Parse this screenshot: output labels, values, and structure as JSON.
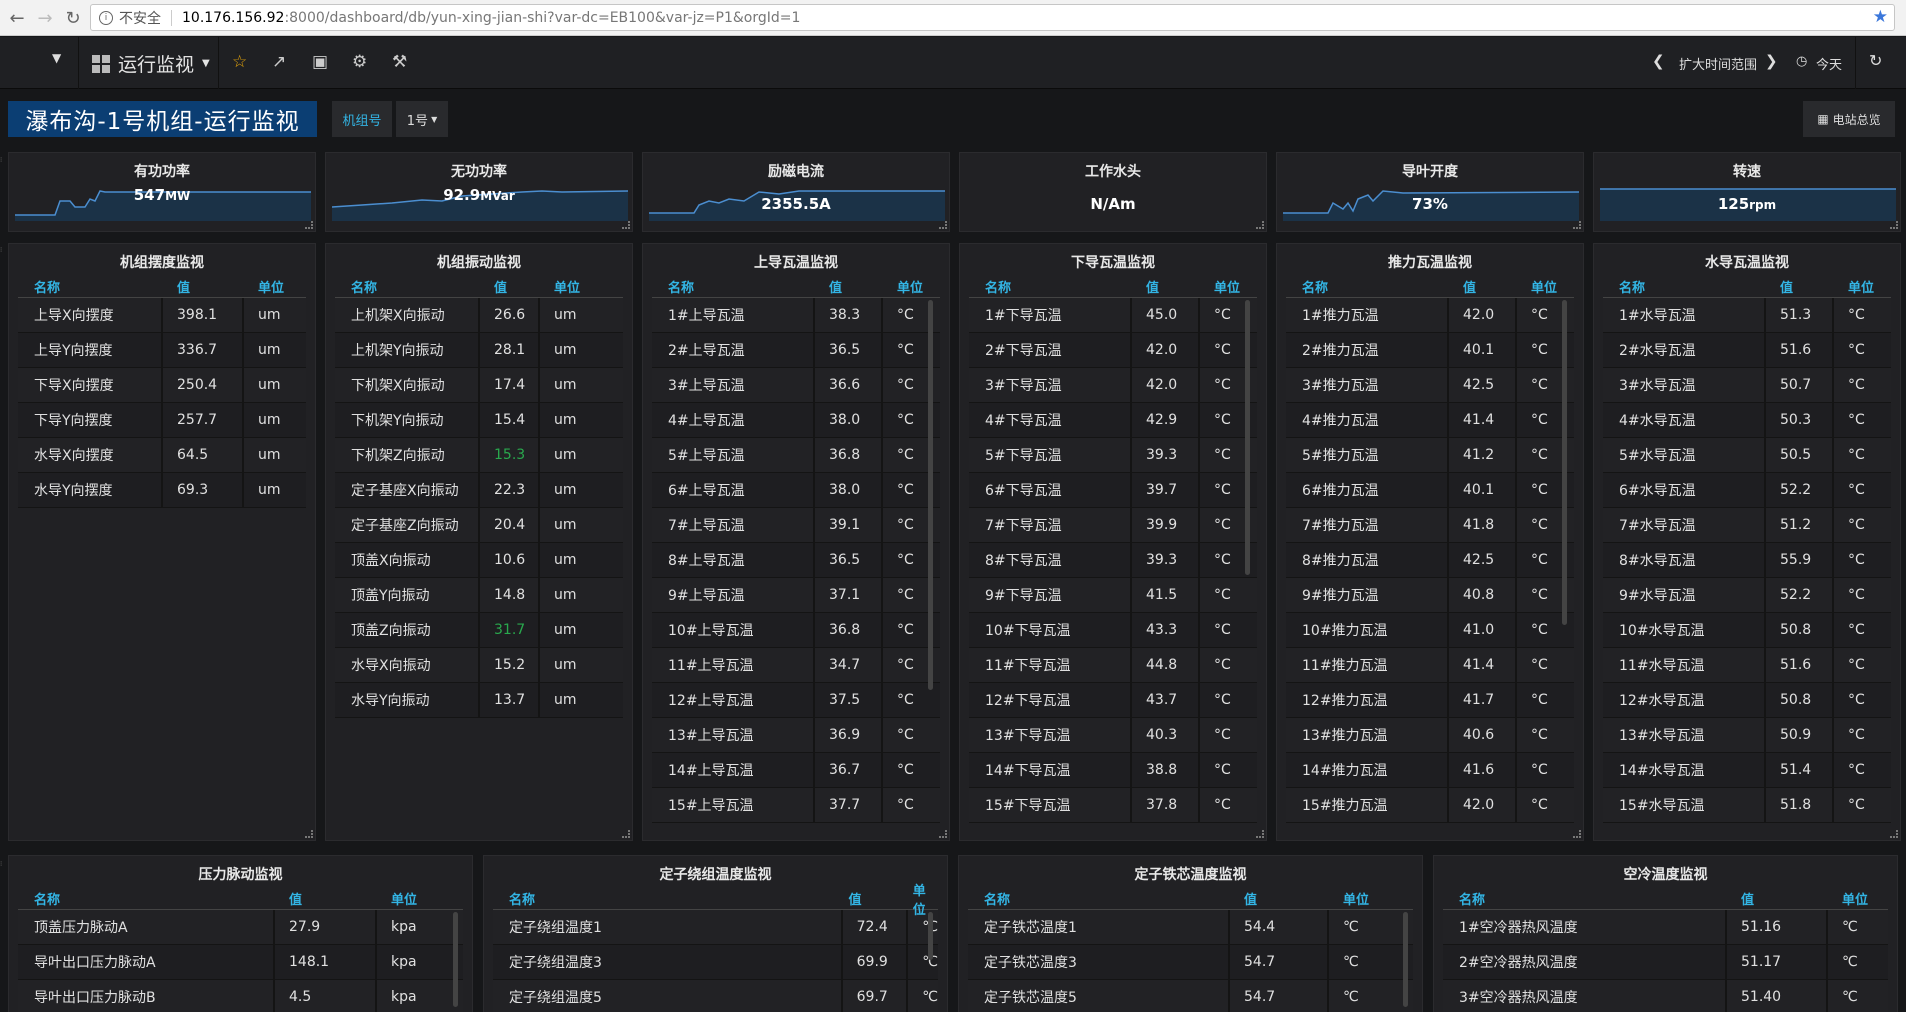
{
  "browser": {
    "insecure": "不安全",
    "host": "10.176.156.92",
    "path": ":8000/dashboard/db/yun-xing-jian-shi?var-dc=EB100&var-jz=P1&orgId=1"
  },
  "nav": {
    "dashboard_name": "运行监视",
    "time_range_label": "扩大时间范围",
    "time_today": "今天"
  },
  "header": {
    "title": "瀑布沟-1号机组-运行监视",
    "var_label": "机组号",
    "var_value": "1号",
    "station_button": "电站总览"
  },
  "stats": [
    {
      "title": "有功功率",
      "value": "547",
      "unit": "MW"
    },
    {
      "title": "无功功率",
      "value": "92.9",
      "unit": "MVar"
    },
    {
      "title": "励磁电流",
      "value": "2355.5A",
      "unit": ""
    },
    {
      "title": "工作水头",
      "value": "N/Am",
      "unit": ""
    },
    {
      "title": "导叶开度",
      "value": "73%",
      "unit": ""
    },
    {
      "title": "转速",
      "value": "125",
      "unit": "rpm"
    }
  ],
  "columns": {
    "name": "名称",
    "value": "值",
    "unit": "单位"
  },
  "panels": [
    {
      "title": "机组摆度监视",
      "rows": [
        [
          "上导X向摆度",
          "398.1",
          "um"
        ],
        [
          "上导Y向摆度",
          "336.7",
          "um"
        ],
        [
          "下导X向摆度",
          "250.4",
          "um"
        ],
        [
          "下导Y向摆度",
          "257.7",
          "um"
        ],
        [
          "水导X向摆度",
          "64.5",
          "um"
        ],
        [
          "水导Y向摆度",
          "69.3",
          "um"
        ]
      ]
    },
    {
      "title": "机组振动监视",
      "rows": [
        [
          "上机架X向振动",
          "26.6",
          "um"
        ],
        [
          "上机架Y向振动",
          "28.1",
          "um"
        ],
        [
          "下机架X向振动",
          "17.4",
          "um"
        ],
        [
          "下机架Y向振动",
          "15.4",
          "um"
        ],
        [
          "下机架Z向振动",
          "15.3",
          "um"
        ],
        [
          "定子基座X向振动",
          "22.3",
          "um"
        ],
        [
          "定子基座Z向振动",
          "20.4",
          "um"
        ],
        [
          "顶盖X向振动",
          "10.6",
          "um"
        ],
        [
          "顶盖Y向振动",
          "14.8",
          "um"
        ],
        [
          "顶盖Z向振动",
          "31.7",
          "um"
        ],
        [
          "水导X向振动",
          "15.2",
          "um"
        ],
        [
          "水导Y向振动",
          "13.7",
          "um"
        ]
      ]
    },
    {
      "title": "上导瓦温监视",
      "rows": [
        [
          "1#上导瓦温",
          "38.3",
          "°C"
        ],
        [
          "2#上导瓦温",
          "36.5",
          "°C"
        ],
        [
          "3#上导瓦温",
          "36.6",
          "°C"
        ],
        [
          "4#上导瓦温",
          "38.0",
          "°C"
        ],
        [
          "5#上导瓦温",
          "36.8",
          "°C"
        ],
        [
          "6#上导瓦温",
          "38.0",
          "°C"
        ],
        [
          "7#上导瓦温",
          "39.1",
          "°C"
        ],
        [
          "8#上导瓦温",
          "36.5",
          "°C"
        ],
        [
          "9#上导瓦温",
          "37.1",
          "°C"
        ],
        [
          "10#上导瓦温",
          "36.8",
          "°C"
        ],
        [
          "11#上导瓦温",
          "34.7",
          "°C"
        ],
        [
          "12#上导瓦温",
          "37.5",
          "°C"
        ],
        [
          "13#上导瓦温",
          "36.9",
          "°C"
        ],
        [
          "14#上导瓦温",
          "36.7",
          "°C"
        ],
        [
          "15#上导瓦温",
          "37.7",
          "°C"
        ]
      ]
    },
    {
      "title": "下导瓦温监视",
      "rows": [
        [
          "1#下导瓦温",
          "45.0",
          "°C"
        ],
        [
          "2#下导瓦温",
          "42.0",
          "°C"
        ],
        [
          "3#下导瓦温",
          "42.0",
          "°C"
        ],
        [
          "4#下导瓦温",
          "42.9",
          "°C"
        ],
        [
          "5#下导瓦温",
          "39.3",
          "°C"
        ],
        [
          "6#下导瓦温",
          "39.7",
          "°C"
        ],
        [
          "7#下导瓦温",
          "39.9",
          "°C"
        ],
        [
          "8#下导瓦温",
          "39.3",
          "°C"
        ],
        [
          "9#下导瓦温",
          "41.5",
          "°C"
        ],
        [
          "10#下导瓦温",
          "43.3",
          "°C"
        ],
        [
          "11#下导瓦温",
          "44.8",
          "°C"
        ],
        [
          "12#下导瓦温",
          "43.7",
          "°C"
        ],
        [
          "13#下导瓦温",
          "40.3",
          "°C"
        ],
        [
          "14#下导瓦温",
          "38.8",
          "°C"
        ],
        [
          "15#下导瓦温",
          "37.8",
          "°C"
        ]
      ]
    },
    {
      "title": "推力瓦温监视",
      "rows": [
        [
          "1#推力瓦温",
          "42.0",
          "°C"
        ],
        [
          "2#推力瓦温",
          "40.1",
          "°C"
        ],
        [
          "3#推力瓦温",
          "42.5",
          "°C"
        ],
        [
          "4#推力瓦温",
          "41.4",
          "°C"
        ],
        [
          "5#推力瓦温",
          "41.2",
          "°C"
        ],
        [
          "6#推力瓦温",
          "40.1",
          "°C"
        ],
        [
          "7#推力瓦温",
          "41.8",
          "°C"
        ],
        [
          "8#推力瓦温",
          "42.5",
          "°C"
        ],
        [
          "9#推力瓦温",
          "40.8",
          "°C"
        ],
        [
          "10#推力瓦温",
          "41.0",
          "°C"
        ],
        [
          "11#推力瓦温",
          "41.4",
          "°C"
        ],
        [
          "12#推力瓦温",
          "41.7",
          "°C"
        ],
        [
          "13#推力瓦温",
          "40.6",
          "°C"
        ],
        [
          "14#推力瓦温",
          "41.6",
          "°C"
        ],
        [
          "15#推力瓦温",
          "42.0",
          "°C"
        ]
      ]
    },
    {
      "title": "水导瓦温监视",
      "rows": [
        [
          "1#水导瓦温",
          "51.3",
          "°C"
        ],
        [
          "2#水导瓦温",
          "51.6",
          "°C"
        ],
        [
          "3#水导瓦温",
          "50.7",
          "°C"
        ],
        [
          "4#水导瓦温",
          "50.3",
          "°C"
        ],
        [
          "5#水导瓦温",
          "50.5",
          "°C"
        ],
        [
          "6#水导瓦温",
          "52.2",
          "°C"
        ],
        [
          "7#水导瓦温",
          "51.2",
          "°C"
        ],
        [
          "8#水导瓦温",
          "55.9",
          "°C"
        ],
        [
          "9#水导瓦温",
          "52.2",
          "°C"
        ],
        [
          "10#水导瓦温",
          "50.8",
          "°C"
        ],
        [
          "11#水导瓦温",
          "51.6",
          "°C"
        ],
        [
          "12#水导瓦温",
          "50.8",
          "°C"
        ],
        [
          "13#水导瓦温",
          "50.9",
          "°C"
        ],
        [
          "14#水导瓦温",
          "51.4",
          "°C"
        ],
        [
          "15#水导瓦温",
          "51.8",
          "°C"
        ]
      ]
    },
    {
      "title": "压力脉动监视",
      "rows": [
        [
          "顶盖压力脉动A",
          "27.9",
          "kpa"
        ],
        [
          "导叶出口压力脉动A",
          "148.1",
          "kpa"
        ],
        [
          "导叶出口压力脉动B",
          "4.5",
          "kpa"
        ]
      ]
    },
    {
      "title": "定子绕组温度监视",
      "rows": [
        [
          "定子绕组温度1",
          "72.4",
          "℃"
        ],
        [
          "定子绕组温度3",
          "69.9",
          "℃"
        ],
        [
          "定子绕组温度5",
          "69.7",
          "℃"
        ]
      ]
    },
    {
      "title": "定子铁芯温度监视",
      "rows": [
        [
          "定子铁芯温度1",
          "54.4",
          "℃"
        ],
        [
          "定子铁芯温度3",
          "54.7",
          "℃"
        ],
        [
          "定子铁芯温度5",
          "54.7",
          "℃"
        ]
      ]
    },
    {
      "title": "空冷温度监视",
      "rows": [
        [
          "1#空冷器热风温度",
          "51.16",
          "℃"
        ],
        [
          "2#空冷器热风温度",
          "51.17",
          "℃"
        ],
        [
          "3#空冷器热风温度",
          "51.40",
          "℃"
        ]
      ]
    }
  ],
  "colors": {
    "accent": "#33b5e5",
    "title_bg": "#0b3e73",
    "panel_bg": "#212124",
    "page_bg": "#161719",
    "highlight_value": "#29a84d",
    "spark_fill": "#1b3247",
    "spark_line": "#4b8ed0"
  }
}
